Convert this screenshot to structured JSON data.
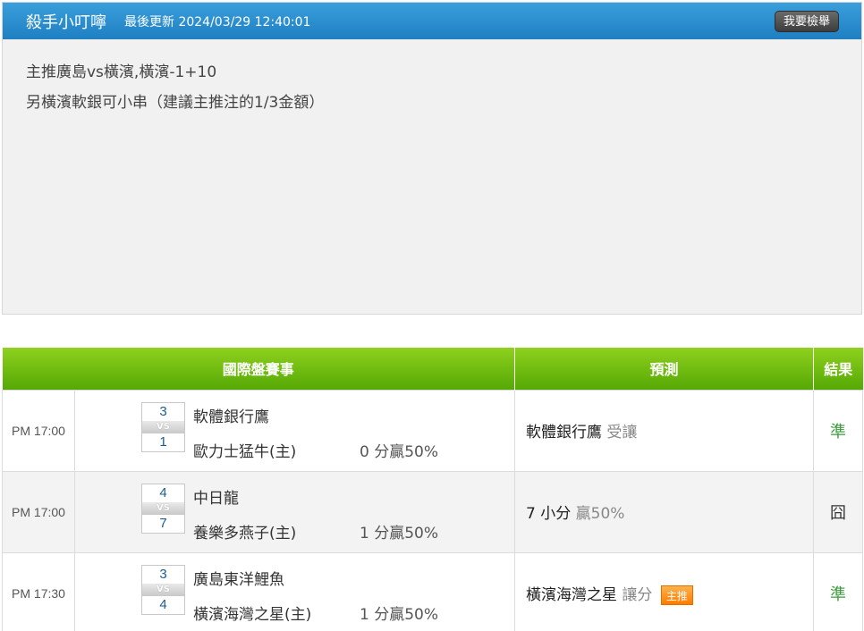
{
  "card": {
    "title": "殺手小叮嚀",
    "updated": "最後更新 2024/03/29 12:40:01",
    "report_button": "我要檢舉",
    "lines": [
      "主推廣島vs橫濱,橫濱-1+10",
      "另橫濱軟銀可小串（建議主推注的1/3金額）"
    ]
  },
  "table": {
    "headers": [
      "國際盤賽事",
      "預測",
      "結果"
    ],
    "vs_label": "VS",
    "rows": [
      {
        "time": "PM 17:00",
        "score_home": "3",
        "score_away": "1",
        "team_home": "軟體銀行鷹",
        "team_away": "歐力士猛牛(主)",
        "line": "0 分贏50%",
        "pred_main": "軟體銀行鷹",
        "pred_sub": "受讓",
        "pred_badge": "",
        "result": "準"
      },
      {
        "time": "PM 17:00",
        "score_home": "4",
        "score_away": "7",
        "team_home": "中日龍",
        "team_away": "養樂多燕子(主)",
        "line": "1 分贏50%",
        "pred_main": "7 小分",
        "pred_sub": "贏50%",
        "pred_badge": "",
        "result": "囧"
      },
      {
        "time": "PM 17:30",
        "score_home": "3",
        "score_away": "4",
        "team_home": "廣島東洋鯉魚",
        "team_away": "橫濱海灣之星(主)",
        "line": "1 分贏50%",
        "pred_main": "橫濱海灣之星",
        "pred_sub": "讓分",
        "pred_badge": "主推",
        "result": "準"
      }
    ]
  },
  "colors": {
    "header_blue": "#2a8fd0",
    "header_green": "#6cbc0e",
    "result_hit": "#3b9c3b",
    "badge_orange": "#ff8a00"
  }
}
